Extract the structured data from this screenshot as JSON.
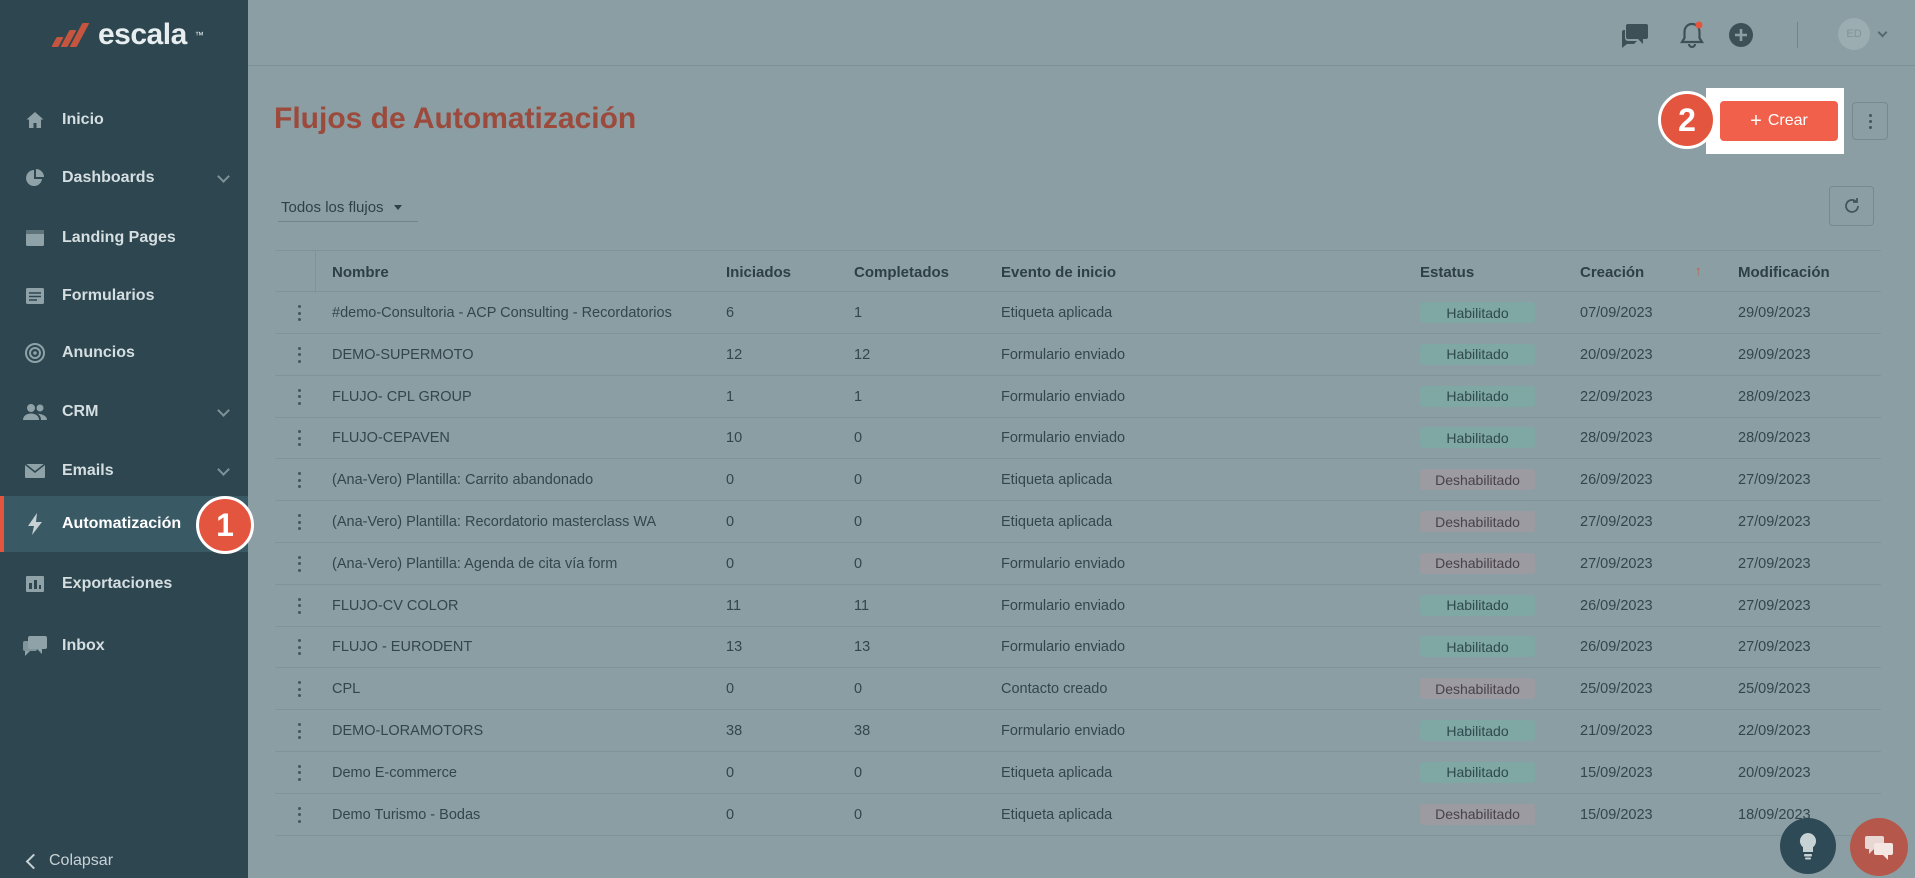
{
  "brand": {
    "name": "escala",
    "tm": "™"
  },
  "sidebar": {
    "items": [
      {
        "label": "Inicio",
        "icon": "home-icon"
      },
      {
        "label": "Dashboards",
        "icon": "pie-chart-icon",
        "expandable": true
      },
      {
        "label": "Landing Pages",
        "icon": "browser-window-icon"
      },
      {
        "label": "Formularios",
        "icon": "form-icon"
      },
      {
        "label": "Anuncios",
        "icon": "target-icon"
      },
      {
        "label": "CRM",
        "icon": "people-icon",
        "expandable": true
      },
      {
        "label": "Emails",
        "icon": "envelope-icon",
        "expandable": true
      },
      {
        "label": "Automatización",
        "icon": "lightning-icon",
        "active": true
      },
      {
        "label": "Exportaciones",
        "icon": "bar-chart-icon"
      },
      {
        "label": "Inbox",
        "icon": "chat-bubbles-icon"
      }
    ],
    "collapse_label": "Colapsar"
  },
  "steps": {
    "one": "1",
    "two": "2"
  },
  "topbar": {
    "avatar_initials": "ED"
  },
  "page": {
    "title": "Flujos de Automatización",
    "create_label": "Crear",
    "filter_label": "Todos los flujos"
  },
  "table": {
    "columns": [
      "Nombre",
      "Iniciados",
      "Completados",
      "Evento de inicio",
      "Estatus",
      "Creación",
      "Modificación"
    ],
    "rows": [
      {
        "name": "#demo-Consultoria - ACP Consulting - Recordatorios",
        "started": "6",
        "completed": "1",
        "event": "Etiqueta aplicada",
        "status": "Habilitado",
        "enabled": true,
        "created": "07/09/2023",
        "modified": "29/09/2023"
      },
      {
        "name": "DEMO-SUPERMOTO",
        "started": "12",
        "completed": "12",
        "event": "Formulario enviado",
        "status": "Habilitado",
        "enabled": true,
        "created": "20/09/2023",
        "modified": "29/09/2023"
      },
      {
        "name": "FLUJO- CPL GROUP",
        "started": "1",
        "completed": "1",
        "event": "Formulario enviado",
        "status": "Habilitado",
        "enabled": true,
        "created": "22/09/2023",
        "modified": "28/09/2023"
      },
      {
        "name": "FLUJO-CEPAVEN",
        "started": "10",
        "completed": "0",
        "event": "Formulario enviado",
        "status": "Habilitado",
        "enabled": true,
        "created": "28/09/2023",
        "modified": "28/09/2023"
      },
      {
        "name": "(Ana-Vero) Plantilla: Carrito abandonado",
        "started": "0",
        "completed": "0",
        "event": "Etiqueta aplicada",
        "status": "Deshabilitado",
        "enabled": false,
        "created": "26/09/2023",
        "modified": "27/09/2023"
      },
      {
        "name": "(Ana-Vero) Plantilla: Recordatorio masterclass WA",
        "started": "0",
        "completed": "0",
        "event": "Etiqueta aplicada",
        "status": "Deshabilitado",
        "enabled": false,
        "created": "27/09/2023",
        "modified": "27/09/2023"
      },
      {
        "name": "(Ana-Vero) Plantilla: Agenda de cita vía form",
        "started": "0",
        "completed": "0",
        "event": "Formulario enviado",
        "status": "Deshabilitado",
        "enabled": false,
        "created": "27/09/2023",
        "modified": "27/09/2023"
      },
      {
        "name": "FLUJO-CV COLOR",
        "started": "11",
        "completed": "11",
        "event": "Formulario enviado",
        "status": "Habilitado",
        "enabled": true,
        "created": "26/09/2023",
        "modified": "27/09/2023"
      },
      {
        "name": "FLUJO - EURODENT",
        "started": "13",
        "completed": "13",
        "event": "Formulario enviado",
        "status": "Habilitado",
        "enabled": true,
        "created": "26/09/2023",
        "modified": "27/09/2023"
      },
      {
        "name": "CPL",
        "started": "0",
        "completed": "0",
        "event": "Contacto creado",
        "status": "Deshabilitado",
        "enabled": false,
        "created": "25/09/2023",
        "modified": "25/09/2023"
      },
      {
        "name": "DEMO-LORAMOTORS",
        "started": "38",
        "completed": "38",
        "event": "Formulario enviado",
        "status": "Habilitado",
        "enabled": true,
        "created": "21/09/2023",
        "modified": "22/09/2023"
      },
      {
        "name": "Demo E-commerce",
        "started": "0",
        "completed": "0",
        "event": "Etiqueta aplicada",
        "status": "Habilitado",
        "enabled": true,
        "created": "15/09/2023",
        "modified": "20/09/2023"
      },
      {
        "name": "Demo Turismo - Bodas",
        "started": "0",
        "completed": "0",
        "event": "Etiqueta aplicada",
        "status": "Deshabilitado",
        "enabled": false,
        "created": "15/09/2023",
        "modified": "18/09/2023"
      }
    ]
  },
  "colors": {
    "accent": "#f0604a",
    "sidebar": "#2d4650",
    "enabled": "#7fa7a4",
    "disabled": "#9b9ba1"
  }
}
